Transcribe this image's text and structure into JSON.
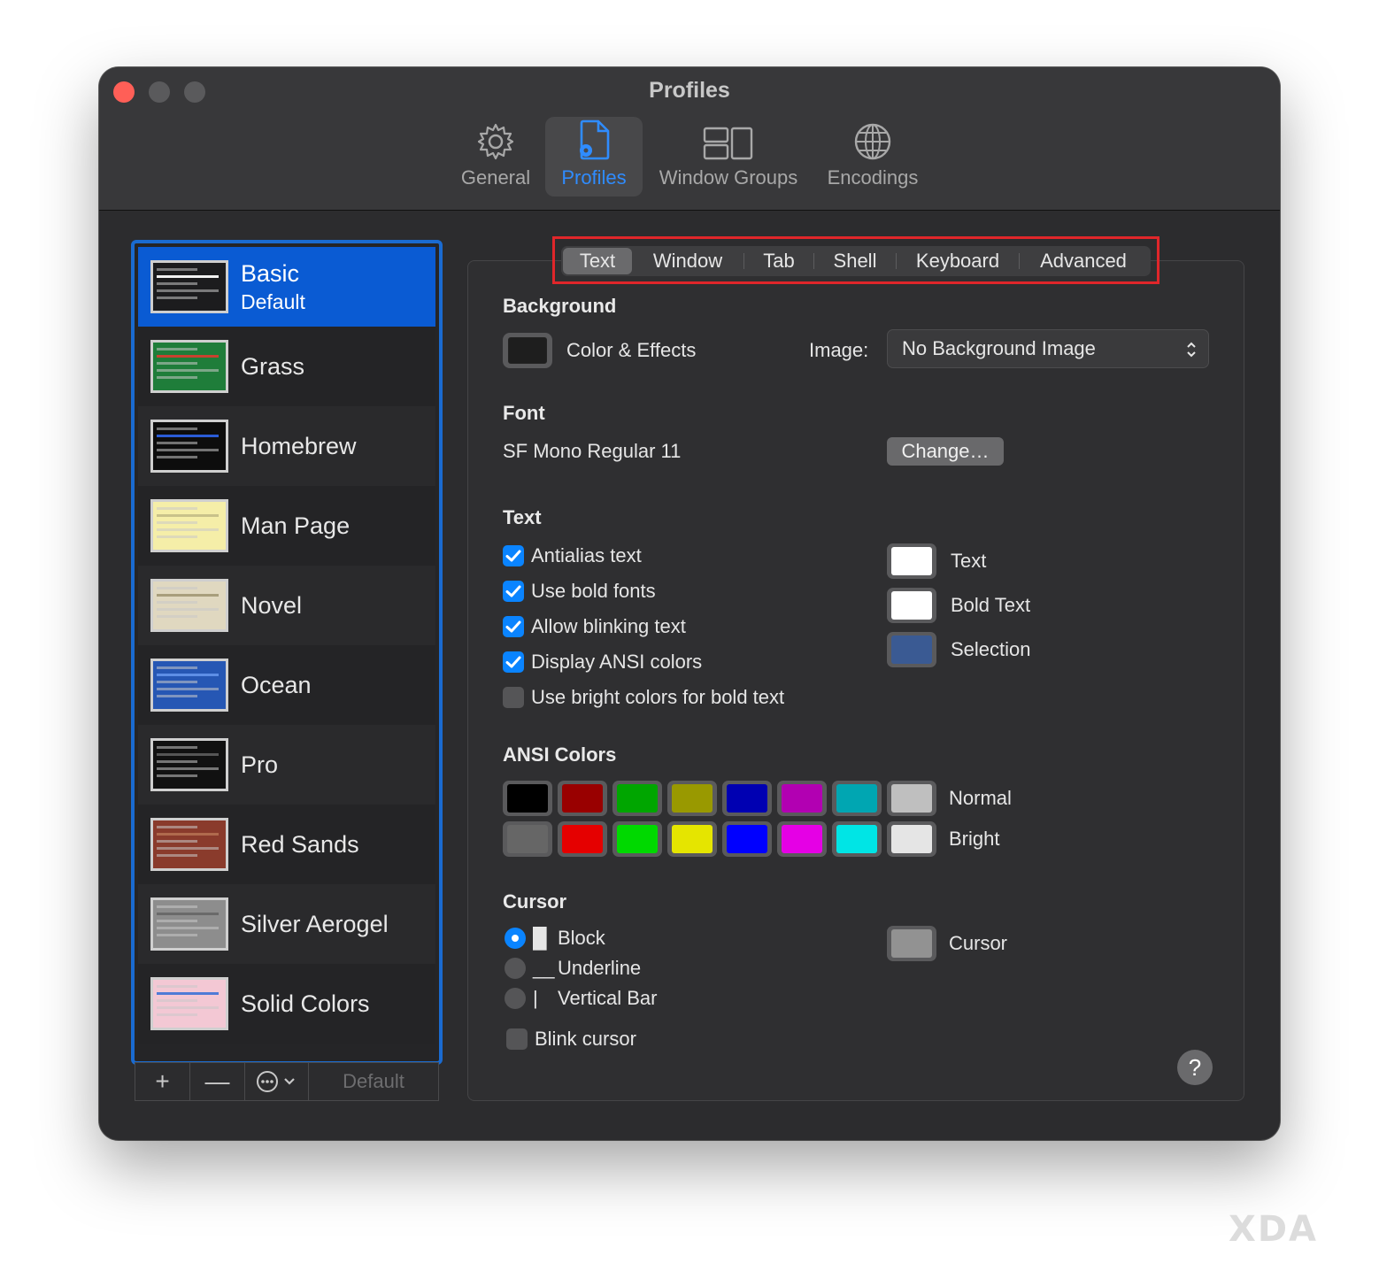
{
  "window": {
    "title": "Profiles"
  },
  "toolbar": {
    "items": [
      {
        "label": "General",
        "icon": "gear-icon"
      },
      {
        "label": "Profiles",
        "icon": "profile-document-icon",
        "active": true
      },
      {
        "label": "Window Groups",
        "icon": "window-groups-icon"
      },
      {
        "label": "Encodings",
        "icon": "globe-icon"
      }
    ]
  },
  "profiles": [
    {
      "name": "Basic",
      "sub": "Default",
      "selected": true,
      "thumb_bg": "#1c1c1e",
      "thumb_band": "#f2f2f2"
    },
    {
      "name": "Grass",
      "thumb_bg": "#1f7d3a",
      "thumb_band": "#c8422f"
    },
    {
      "name": "Homebrew",
      "thumb_bg": "#0d0d0d",
      "thumb_band": "#2a5cd6"
    },
    {
      "name": "Man Page",
      "thumb_bg": "#f5eea8",
      "thumb_band": "#c9c28a"
    },
    {
      "name": "Novel",
      "thumb_bg": "#e0d8c0",
      "thumb_band": "#a89e7c"
    },
    {
      "name": "Ocean",
      "thumb_bg": "#2657b4",
      "thumb_band": "#5d8ee6"
    },
    {
      "name": "Pro",
      "thumb_bg": "#111111",
      "thumb_band": "#555555"
    },
    {
      "name": "Red Sands",
      "thumb_bg": "#8a3b2c",
      "thumb_band": "#b06a4d"
    },
    {
      "name": "Silver Aerogel",
      "thumb_bg": "#8d8d8d",
      "thumb_band": "#6a6a6a"
    },
    {
      "name": "Solid Colors",
      "thumb_bg": "#f3c8d4",
      "thumb_band": "#4f7bd6"
    }
  ],
  "sidebar_toolbar": {
    "add": "+",
    "remove": "—",
    "more": "more-options-icon",
    "default_label": "Default"
  },
  "tabs": [
    "Text",
    "Window",
    "Tab",
    "Shell",
    "Keyboard",
    "Advanced"
  ],
  "background": {
    "heading": "Background",
    "color_effects_label": "Color & Effects",
    "image_label": "Image:",
    "image_value": "No Background Image"
  },
  "font": {
    "heading": "Font",
    "value": "SF Mono Regular 11",
    "change_label": "Change…"
  },
  "text": {
    "heading": "Text",
    "checkboxes": [
      {
        "label": "Antialias text",
        "checked": true
      },
      {
        "label": "Use bold fonts",
        "checked": true
      },
      {
        "label": "Allow blinking text",
        "checked": true
      },
      {
        "label": "Display ANSI colors",
        "checked": true
      },
      {
        "label": "Use bright colors for bold text",
        "checked": false
      }
    ],
    "colors": [
      {
        "label": "Text",
        "color": "#ffffff"
      },
      {
        "label": "Bold Text",
        "color": "#ffffff"
      },
      {
        "label": "Selection",
        "color": "#3a5a93"
      }
    ]
  },
  "ansi": {
    "heading": "ANSI Colors",
    "normal_label": "Normal",
    "bright_label": "Bright",
    "normal": [
      "#000000",
      "#990000",
      "#00a600",
      "#999900",
      "#0000b2",
      "#b200b2",
      "#00a6b2",
      "#bfbfbf"
    ],
    "bright": [
      "#666666",
      "#e50000",
      "#00d900",
      "#e5e500",
      "#0000ff",
      "#e500e5",
      "#00e5e5",
      "#e5e5e5"
    ]
  },
  "cursor": {
    "heading": "Cursor",
    "options": [
      {
        "glyph": "█",
        "label": "Block",
        "selected": true
      },
      {
        "glyph": "__",
        "label": "Underline",
        "selected": false
      },
      {
        "glyph": "|",
        "label": "Vertical Bar",
        "selected": false
      }
    ],
    "blink_label": "Blink cursor",
    "color_label": "Cursor",
    "color": "#929292"
  },
  "help_label": "?",
  "watermark": "XDA"
}
